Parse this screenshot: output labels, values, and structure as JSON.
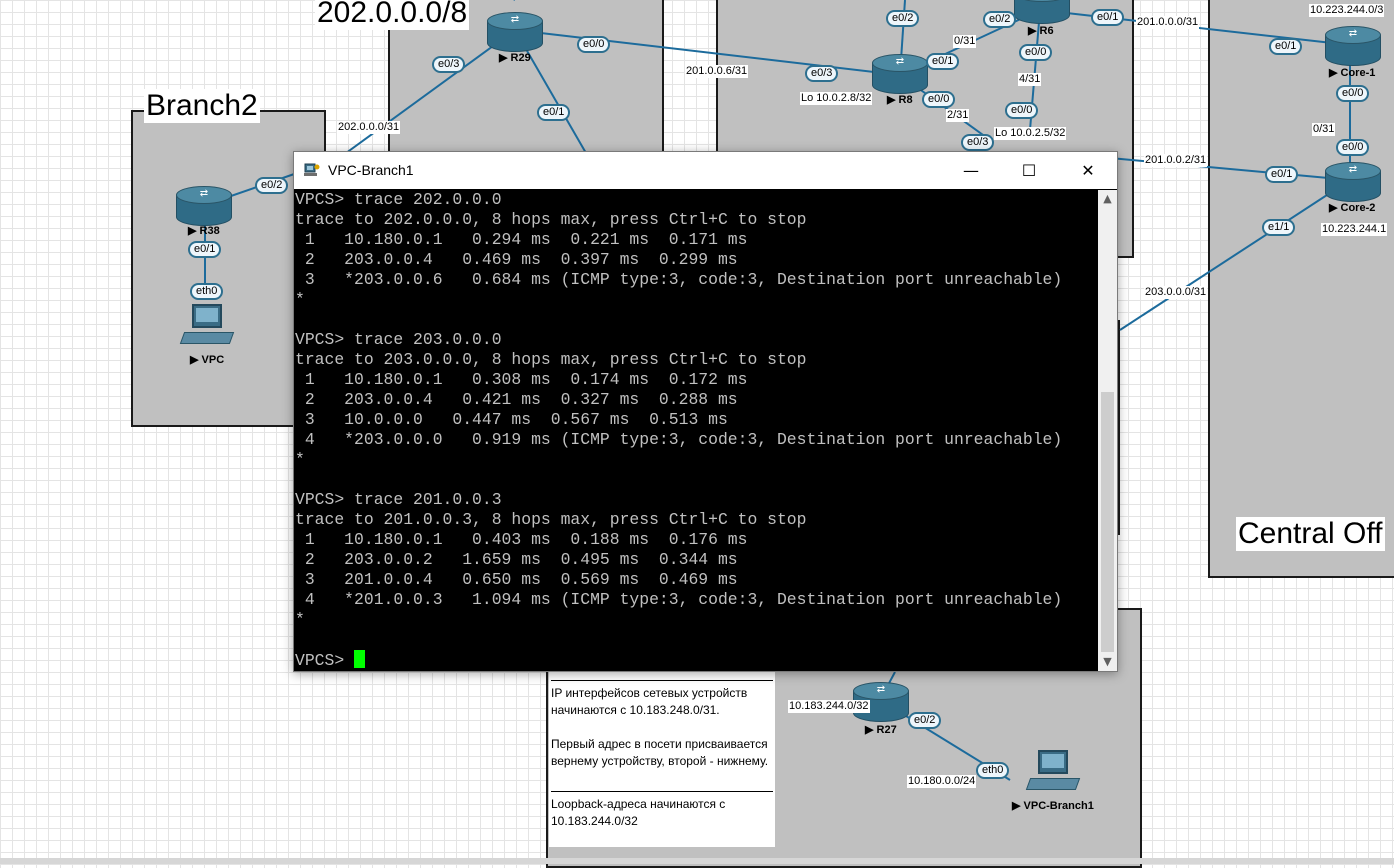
{
  "colors": {
    "zone_fill": "#c0c0c0",
    "link": "#1c6b9c",
    "router": "#2f6b86",
    "terminal_bg": "#000000",
    "terminal_fg": "#c0c0c0",
    "cursor": "#00ff00"
  },
  "zones": {
    "branch2_title": "Branch2",
    "central_office_title": "Central Off",
    "prefix_title": "202.0.0.0/8"
  },
  "devices": {
    "r29": "R29",
    "r38": "R38",
    "vpc": "VPC",
    "r8": "R8",
    "r6": "R6",
    "core1": "Core-1",
    "core2": "Core-2",
    "r27": "R27",
    "vpc_branch1": "VPC-Branch1"
  },
  "interfaces": {
    "r29_e0_3": "e0/3",
    "r29_e0_0": "e0/0",
    "r29_e0_1": "e0/1",
    "r38_e0_2": "e0/2",
    "r38_e0_1": "e0/1",
    "vpc_eth0": "eth0",
    "r8_e0_2": "e0/2",
    "r8_e0_1": "e0/1",
    "r8_e0_3": "e0/3",
    "r8_e0_0": "e0/0",
    "r6_e0_2": "e0/2",
    "r6_e0_1": "e0/1",
    "r6_e0_0": "e0/0",
    "mid_e0_0": "e0/0",
    "mid_e0_3": "e0/3",
    "core1_e0_1": "e0/1",
    "core1_e0_0": "e0/0",
    "core2_e0_0": "e0/0",
    "core2_e0_1": "e0/1",
    "core2_e1_1": "e1/1",
    "r27_e0_2": "e0/2",
    "vpcb1_eth0": "eth0"
  },
  "networks": {
    "n202_31": "202.0.0.0/31",
    "n201_6": "201.0.0.6/31",
    "lo_r8": "Lo 10.0.2.8/32",
    "n0_31_a": "0/31",
    "n4_31": "4/31",
    "n2_31": "2/31",
    "lo_2_5": "Lo 10.0.2.5/32",
    "n201_0": "201.0.0.0/31",
    "n10_223_top": "10.223.244.0/3",
    "n0_31_b": "0/31",
    "n201_2": "201.0.0.2/31",
    "n10_223_bottom": "10.223.244.1",
    "n203_0": "203.0.0.0/31",
    "n10_183_244": "10.183.244.0/32",
    "n10_180": "10.180.0.0/24"
  },
  "note": {
    "line1": "IP интерфейсов сетевых устройств",
    "line2": "начинаются с 10.183.248.0/31.",
    "line3": "Первый адрес в посети присваивается",
    "line4": "вернему устройству, второй - нижнему.",
    "line5": "Loopback-адреса начинаются с",
    "line6": "10.183.244.0/32"
  },
  "window": {
    "title": "VPC-Branch1",
    "minimize": "—",
    "maximize": "☐",
    "close": "✕"
  },
  "terminal": {
    "lines": [
      "VPCS> trace 202.0.0.0",
      "trace to 202.0.0.0, 8 hops max, press Ctrl+C to stop",
      " 1   10.180.0.1   0.294 ms  0.221 ms  0.171 ms",
      " 2   203.0.0.4   0.469 ms  0.397 ms  0.299 ms",
      " 3   *203.0.0.6   0.684 ms (ICMP type:3, code:3, Destination port unreachable)",
      "*",
      "",
      "VPCS> trace 203.0.0.0",
      "trace to 203.0.0.0, 8 hops max, press Ctrl+C to stop",
      " 1   10.180.0.1   0.308 ms  0.174 ms  0.172 ms",
      " 2   203.0.0.4   0.421 ms  0.327 ms  0.288 ms",
      " 3   10.0.0.0   0.447 ms  0.567 ms  0.513 ms",
      " 4   *203.0.0.0   0.919 ms (ICMP type:3, code:3, Destination port unreachable)",
      "*",
      "",
      "VPCS> trace 201.0.0.3",
      "trace to 201.0.0.3, 8 hops max, press Ctrl+C to stop",
      " 1   10.180.0.1   0.403 ms  0.188 ms  0.176 ms",
      " 2   203.0.0.2   1.659 ms  0.495 ms  0.344 ms",
      " 3   201.0.0.4   0.650 ms  0.569 ms  0.469 ms",
      " 4   *201.0.0.3   1.094 ms (ICMP type:3, code:3, Destination port unreachable)",
      "*",
      ""
    ],
    "prompt": "VPCS> "
  }
}
